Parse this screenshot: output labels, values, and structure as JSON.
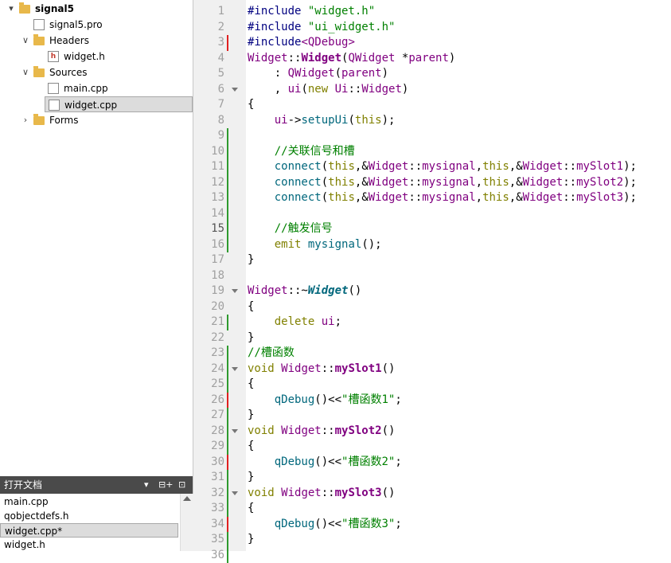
{
  "project_tree": {
    "items": [
      {
        "label": "signal5",
        "depth": 0,
        "arrow": "▾",
        "icon": "project-folder-icon",
        "bold": true
      },
      {
        "label": "signal5.pro",
        "depth": 1,
        "arrow": "",
        "icon": "pro-file-icon"
      },
      {
        "label": "Headers",
        "depth": 1,
        "arrow": "∨",
        "icon": "headers-folder-icon"
      },
      {
        "label": "widget.h",
        "depth": 2,
        "arrow": "",
        "icon": "header-file-icon"
      },
      {
        "label": "Sources",
        "depth": 1,
        "arrow": "∨",
        "icon": "sources-folder-icon"
      },
      {
        "label": "main.cpp",
        "depth": 2,
        "arrow": "",
        "icon": "cpp-file-icon"
      },
      {
        "label": "widget.cpp",
        "depth": 2,
        "arrow": "",
        "icon": "cpp-file-icon",
        "selected": true
      },
      {
        "label": "Forms",
        "depth": 1,
        "arrow": "›",
        "icon": "forms-folder-icon"
      }
    ]
  },
  "open_documents": {
    "title": "打开文档",
    "items": [
      {
        "label": "main.cpp"
      },
      {
        "label": "qobjectdefs.h"
      },
      {
        "label": "widget.cpp*",
        "selected": true
      },
      {
        "label": "widget.h"
      }
    ]
  },
  "editor": {
    "current_line": 15,
    "lines": [
      {
        "n": "1",
        "mark": "",
        "fold": false,
        "tokens": [
          [
            "pp",
            "#include "
          ],
          [
            "str",
            "\"widget.h\""
          ]
        ]
      },
      {
        "n": "2",
        "mark": "",
        "fold": false,
        "tokens": [
          [
            "pp",
            "#include "
          ],
          [
            "str",
            "\"ui_widget.h\""
          ]
        ]
      },
      {
        "n": "3",
        "mark": "red",
        "fold": false,
        "tokens": [
          [
            "pp",
            "#include"
          ],
          [
            "type",
            "<QDebug>"
          ]
        ]
      },
      {
        "n": "4",
        "mark": "",
        "fold": false,
        "tokens": [
          [
            "type",
            "Widget"
          ],
          [
            "pl",
            "::"
          ],
          [
            "type b",
            "Widget"
          ],
          [
            "pl",
            "("
          ],
          [
            "type",
            "QWidget"
          ],
          [
            "pl",
            " *"
          ],
          [
            "type",
            "parent"
          ],
          [
            "pl",
            ")"
          ]
        ]
      },
      {
        "n": "5",
        "mark": "",
        "fold": false,
        "tokens": [
          [
            "pl",
            "    : "
          ],
          [
            "type",
            "QWidget"
          ],
          [
            "pl",
            "("
          ],
          [
            "type",
            "parent"
          ],
          [
            "pl",
            ")"
          ]
        ]
      },
      {
        "n": "6",
        "mark": "",
        "fold": true,
        "tokens": [
          [
            "pl",
            "    , "
          ],
          [
            "type",
            "ui"
          ],
          [
            "pl",
            "("
          ],
          [
            "kw",
            "new"
          ],
          [
            "pl",
            " "
          ],
          [
            "type",
            "Ui"
          ],
          [
            "pl",
            "::"
          ],
          [
            "type",
            "Widget"
          ],
          [
            "pl",
            ")"
          ]
        ]
      },
      {
        "n": "7",
        "mark": "",
        "fold": false,
        "tokens": [
          [
            "pl",
            "{"
          ]
        ]
      },
      {
        "n": "8",
        "mark": "",
        "fold": false,
        "tokens": [
          [
            "pl",
            "    "
          ],
          [
            "type",
            "ui"
          ],
          [
            "pl",
            "->"
          ],
          [
            "fn",
            "setupUi"
          ],
          [
            "pl",
            "("
          ],
          [
            "kw",
            "this"
          ],
          [
            "pl",
            ");"
          ]
        ]
      },
      {
        "n": "9",
        "mark": "green",
        "fold": false,
        "tokens": []
      },
      {
        "n": "10",
        "mark": "green",
        "fold": false,
        "tokens": [
          [
            "cm",
            "    //关联信号和槽"
          ]
        ]
      },
      {
        "n": "11",
        "mark": "green",
        "fold": false,
        "tokens": [
          [
            "pl",
            "    "
          ],
          [
            "fn",
            "connect"
          ],
          [
            "pl",
            "("
          ],
          [
            "kw",
            "this"
          ],
          [
            "pl",
            ",&"
          ],
          [
            "type",
            "Widget"
          ],
          [
            "pl",
            "::"
          ],
          [
            "type",
            "mysignal"
          ],
          [
            "pl",
            ","
          ],
          [
            "kw",
            "this"
          ],
          [
            "pl",
            ",&"
          ],
          [
            "type",
            "Widget"
          ],
          [
            "pl",
            "::"
          ],
          [
            "type",
            "mySlot1"
          ],
          [
            "pl",
            ");"
          ]
        ]
      },
      {
        "n": "12",
        "mark": "green",
        "fold": false,
        "tokens": [
          [
            "pl",
            "    "
          ],
          [
            "fn",
            "connect"
          ],
          [
            "pl",
            "("
          ],
          [
            "kw",
            "this"
          ],
          [
            "pl",
            ",&"
          ],
          [
            "type",
            "Widget"
          ],
          [
            "pl",
            "::"
          ],
          [
            "type",
            "mysignal"
          ],
          [
            "pl",
            ","
          ],
          [
            "kw",
            "this"
          ],
          [
            "pl",
            ",&"
          ],
          [
            "type",
            "Widget"
          ],
          [
            "pl",
            "::"
          ],
          [
            "type",
            "mySlot2"
          ],
          [
            "pl",
            ");"
          ]
        ]
      },
      {
        "n": "13",
        "mark": "green",
        "fold": false,
        "tokens": [
          [
            "pl",
            "    "
          ],
          [
            "fn",
            "connect"
          ],
          [
            "pl",
            "("
          ],
          [
            "kw",
            "this"
          ],
          [
            "pl",
            ",&"
          ],
          [
            "type",
            "Widget"
          ],
          [
            "pl",
            "::"
          ],
          [
            "type",
            "mysignal"
          ],
          [
            "pl",
            ","
          ],
          [
            "kw",
            "this"
          ],
          [
            "pl",
            ",&"
          ],
          [
            "type",
            "Widget"
          ],
          [
            "pl",
            "::"
          ],
          [
            "type",
            "mySlot3"
          ],
          [
            "pl",
            ");"
          ]
        ]
      },
      {
        "n": "14",
        "mark": "green",
        "fold": false,
        "tokens": []
      },
      {
        "n": "15",
        "mark": "green",
        "fold": false,
        "tokens": [
          [
            "cm",
            "    //触发信号"
          ]
        ]
      },
      {
        "n": "16",
        "mark": "green",
        "fold": false,
        "tokens": [
          [
            "pl",
            "    "
          ],
          [
            "kw",
            "emit"
          ],
          [
            "pl",
            " "
          ],
          [
            "fn",
            "mysignal"
          ],
          [
            "pl",
            "();"
          ]
        ]
      },
      {
        "n": "17",
        "mark": "",
        "fold": false,
        "tokens": [
          [
            "pl",
            "}"
          ]
        ]
      },
      {
        "n": "18",
        "mark": "",
        "fold": false,
        "tokens": []
      },
      {
        "n": "19",
        "mark": "",
        "fold": true,
        "tokens": [
          [
            "type",
            "Widget"
          ],
          [
            "pl",
            "::~"
          ],
          [
            "fn bi",
            "Widget"
          ],
          [
            "pl",
            "()"
          ]
        ]
      },
      {
        "n": "20",
        "mark": "",
        "fold": false,
        "tokens": [
          [
            "pl",
            "{"
          ]
        ]
      },
      {
        "n": "21",
        "mark": "green",
        "fold": false,
        "tokens": [
          [
            "pl",
            "    "
          ],
          [
            "kw",
            "delete"
          ],
          [
            "pl",
            " "
          ],
          [
            "type",
            "ui"
          ],
          [
            "pl",
            ";"
          ]
        ]
      },
      {
        "n": "22",
        "mark": "",
        "fold": false,
        "tokens": [
          [
            "pl",
            "}"
          ]
        ]
      },
      {
        "n": "23",
        "mark": "green",
        "fold": false,
        "tokens": [
          [
            "cm",
            "//槽函数"
          ]
        ]
      },
      {
        "n": "24",
        "mark": "green",
        "fold": true,
        "tokens": [
          [
            "kw",
            "void"
          ],
          [
            "pl",
            " "
          ],
          [
            "type",
            "Widget"
          ],
          [
            "pl",
            "::"
          ],
          [
            "type b",
            "mySlot1"
          ],
          [
            "pl",
            "()"
          ]
        ]
      },
      {
        "n": "25",
        "mark": "green",
        "fold": false,
        "tokens": [
          [
            "pl",
            "{"
          ]
        ]
      },
      {
        "n": "26",
        "mark": "red",
        "fold": false,
        "tokens": [
          [
            "pl",
            "    "
          ],
          [
            "fn",
            "qDebug"
          ],
          [
            "pl",
            "()<<"
          ],
          [
            "str",
            "\"槽函数1\""
          ],
          [
            "pl",
            ";"
          ]
        ]
      },
      {
        "n": "27",
        "mark": "green",
        "fold": false,
        "tokens": [
          [
            "pl",
            "}"
          ]
        ]
      },
      {
        "n": "28",
        "mark": "green",
        "fold": true,
        "tokens": [
          [
            "kw",
            "void"
          ],
          [
            "pl",
            " "
          ],
          [
            "type",
            "Widget"
          ],
          [
            "pl",
            "::"
          ],
          [
            "type b",
            "mySlot2"
          ],
          [
            "pl",
            "()"
          ]
        ]
      },
      {
        "n": "29",
        "mark": "green",
        "fold": false,
        "tokens": [
          [
            "pl",
            "{"
          ]
        ]
      },
      {
        "n": "30",
        "mark": "red",
        "fold": false,
        "tokens": [
          [
            "pl",
            "    "
          ],
          [
            "fn",
            "qDebug"
          ],
          [
            "pl",
            "()<<"
          ],
          [
            "str",
            "\"槽函数2\""
          ],
          [
            "pl",
            ";"
          ]
        ]
      },
      {
        "n": "31",
        "mark": "green",
        "fold": false,
        "tokens": [
          [
            "pl",
            "}"
          ]
        ]
      },
      {
        "n": "32",
        "mark": "green",
        "fold": true,
        "tokens": [
          [
            "kw",
            "void"
          ],
          [
            "pl",
            " "
          ],
          [
            "type",
            "Widget"
          ],
          [
            "pl",
            "::"
          ],
          [
            "type b",
            "mySlot3"
          ],
          [
            "pl",
            "()"
          ]
        ]
      },
      {
        "n": "33",
        "mark": "green",
        "fold": false,
        "tokens": [
          [
            "pl",
            "{"
          ]
        ]
      },
      {
        "n": "34",
        "mark": "red",
        "fold": false,
        "tokens": [
          [
            "pl",
            "    "
          ],
          [
            "fn",
            "qDebug"
          ],
          [
            "pl",
            "()<<"
          ],
          [
            "str",
            "\"槽函数3\""
          ],
          [
            "pl",
            ";"
          ]
        ]
      },
      {
        "n": "35",
        "mark": "green",
        "fold": false,
        "tokens": [
          [
            "pl",
            "}"
          ]
        ]
      },
      {
        "n": "36",
        "mark": "green",
        "fold": false,
        "tokens": []
      }
    ]
  },
  "colors": {
    "selection_bg": "#dcdcdc",
    "header_bar_bg": "#4a4a4a",
    "marker_green": "#2e9a2e",
    "marker_red": "#e02020"
  }
}
